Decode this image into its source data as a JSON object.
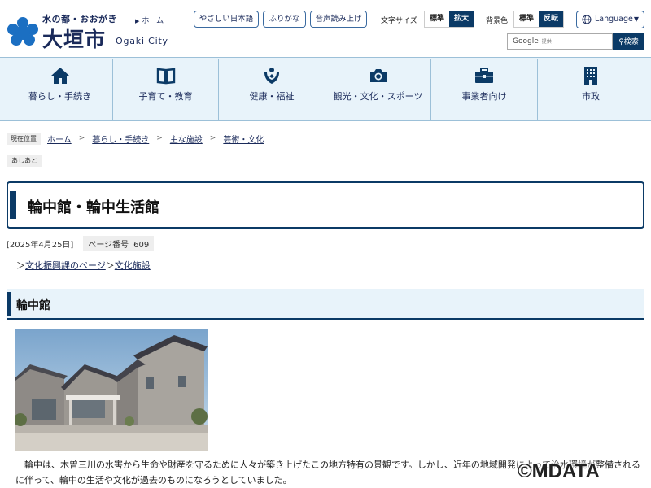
{
  "header": {
    "tagline": "水の都・おおがき",
    "city_name": "大垣市",
    "city_en": "Ogaki City",
    "home_link": "ホーム",
    "easy_japanese": "やさしい日本語",
    "furigana": "ふりがな",
    "read_aloud": "音声読み上げ",
    "font_size_label": "文字サイズ",
    "font_standard": "標準",
    "font_large": "拡大",
    "bg_color_label": "背景色",
    "bg_standard": "標準",
    "bg_invert": "反転",
    "language": "Language",
    "search_brand": "Google",
    "search_brand_sub": "提供",
    "search_button": "検索"
  },
  "nav": [
    {
      "label": "暮らし・手続き",
      "icon": "house-icon"
    },
    {
      "label": "子育て・教育",
      "icon": "book-icon"
    },
    {
      "label": "健康・福祉",
      "icon": "care-hands-icon"
    },
    {
      "label": "観光・文化・スポーツ",
      "icon": "camera-icon"
    },
    {
      "label": "事業者向け",
      "icon": "briefcase-icon"
    },
    {
      "label": "市政",
      "icon": "building-icon"
    }
  ],
  "breadcrumb": {
    "here": "現在位置",
    "items": [
      "ホーム",
      "暮らし・手続き",
      "主な施設",
      "芸術・文化"
    ]
  },
  "category_tag": "あしあと",
  "page": {
    "title": "輪中館・輪中生活館",
    "date": "[2025年4月25日]",
    "page_no_label": "ページ番号",
    "page_no": "609",
    "related_prefix_1": "＞",
    "related_link_1": "文化振興課のページ",
    "related_prefix_2": "＞",
    "related_link_2": "文化施設"
  },
  "section": {
    "heading": "輪中館",
    "body": "輪中は、木曽三川の水害から生命や財産を守るために人々が築き上げたこの地方特有の景観です。しかし、近年の地域開発によって治水環境が整備されるに伴って、輪中の生活や文化が過去のものになろうとしていました。"
  },
  "watermark": "©MDATA",
  "colors": {
    "brand_navy": "#0b3a66",
    "nav_bg": "#e8f3fa",
    "logo_blue": "#1b6fc2"
  }
}
